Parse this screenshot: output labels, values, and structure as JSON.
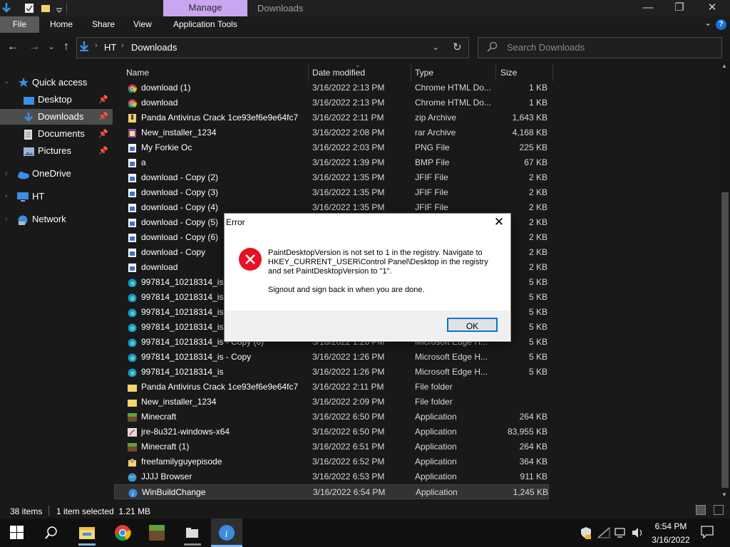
{
  "window": {
    "title": "Downloads",
    "manage_tab": "Manage",
    "controls": {
      "minimize": "—",
      "maximize": "❐",
      "close": "✕"
    }
  },
  "ribbon": {
    "tabs": [
      "File",
      "Home",
      "Share",
      "View",
      "Application Tools"
    ]
  },
  "address": {
    "crumbs": [
      "HT",
      "Downloads"
    ],
    "search_placeholder": "Search Downloads"
  },
  "nav_pane": {
    "items": [
      {
        "label": "Quick access",
        "icon": "star-icon"
      },
      {
        "label": "Desktop",
        "icon": "desktop-icon",
        "pinned": true
      },
      {
        "label": "Downloads",
        "icon": "downloads-icon",
        "pinned": true,
        "selected": true
      },
      {
        "label": "Documents",
        "icon": "documents-icon",
        "pinned": true
      },
      {
        "label": "Pictures",
        "icon": "pictures-icon",
        "pinned": true
      },
      {
        "label": "OneDrive",
        "icon": "cloud-icon"
      },
      {
        "label": "HT",
        "icon": "computer-icon"
      },
      {
        "label": "Network",
        "icon": "network-icon"
      }
    ]
  },
  "columns": {
    "name": "Name",
    "date": "Date modified",
    "type": "Type",
    "size": "Size"
  },
  "files": [
    {
      "name": "download (1)",
      "date": "3/16/2022 2:13 PM",
      "type": "Chrome HTML Do...",
      "size": "1 KB",
      "icon": "chrome-icon"
    },
    {
      "name": "download",
      "date": "3/16/2022 2:13 PM",
      "type": "Chrome HTML Do...",
      "size": "1 KB",
      "icon": "chrome-icon"
    },
    {
      "name": "Panda Antivirus Crack 1ce93ef6e9e64fc7",
      "date": "3/16/2022 2:11 PM",
      "type": "zip Archive",
      "size": "1,643 KB",
      "icon": "zip-archive-icon"
    },
    {
      "name": "New_installer_1234",
      "date": "3/16/2022 2:08 PM",
      "type": "rar Archive",
      "size": "4,168 KB",
      "icon": "rar-archive-icon"
    },
    {
      "name": "My Forkie Oc",
      "date": "3/16/2022 2:03 PM",
      "type": "PNG File",
      "size": "225 KB",
      "icon": "image-file-icon"
    },
    {
      "name": "a",
      "date": "3/16/2022 1:39 PM",
      "type": "BMP File",
      "size": "67 KB",
      "icon": "image-file-icon"
    },
    {
      "name": "download - Copy (2)",
      "date": "3/16/2022 1:35 PM",
      "type": "JFIF File",
      "size": "2 KB",
      "icon": "image-file-icon"
    },
    {
      "name": "download - Copy (3)",
      "date": "3/16/2022 1:35 PM",
      "type": "JFIF File",
      "size": "2 KB",
      "icon": "image-file-icon"
    },
    {
      "name": "download - Copy (4)",
      "date": "3/16/2022 1:35 PM",
      "type": "JFIF File",
      "size": "2 KB",
      "icon": "image-file-icon"
    },
    {
      "name": "download - Copy (5)",
      "date": "",
      "type": "",
      "size": "2 KB",
      "icon": "image-file-icon"
    },
    {
      "name": "download - Copy (6)",
      "date": "",
      "type": "",
      "size": "2 KB",
      "icon": "image-file-icon"
    },
    {
      "name": "download - Copy",
      "date": "",
      "type": "",
      "size": "2 KB",
      "icon": "image-file-icon"
    },
    {
      "name": "download",
      "date": "",
      "type": "",
      "size": "2 KB",
      "icon": "image-file-icon"
    },
    {
      "name": "997814_10218314_is - C",
      "date": "",
      "type": "",
      "size": "5 KB",
      "icon": "edge-icon"
    },
    {
      "name": "997814_10218314_is - C",
      "date": "",
      "type": "",
      "size": "5 KB",
      "icon": "edge-icon"
    },
    {
      "name": "997814_10218314_is - C",
      "date": "",
      "type": "",
      "size": "5 KB",
      "icon": "edge-icon"
    },
    {
      "name": "997814_10218314_is - C",
      "date": "",
      "type": "",
      "size": "5 KB",
      "icon": "edge-icon"
    },
    {
      "name": "997814_10218314_is - Copy (6)",
      "date": "3/16/2022 1:26 PM",
      "type": "Microsoft Edge H...",
      "size": "5 KB",
      "icon": "edge-icon"
    },
    {
      "name": "997814_10218314_is - Copy",
      "date": "3/16/2022 1:26 PM",
      "type": "Microsoft Edge H...",
      "size": "5 KB",
      "icon": "edge-icon"
    },
    {
      "name": "997814_10218314_is",
      "date": "3/16/2022 1:26 PM",
      "type": "Microsoft Edge H...",
      "size": "5 KB",
      "icon": "edge-icon"
    },
    {
      "name": "Panda Antivirus Crack 1ce93ef6e9e64fc7",
      "date": "3/16/2022 2:11 PM",
      "type": "File folder",
      "size": "",
      "icon": "folder-icon"
    },
    {
      "name": "New_installer_1234",
      "date": "3/16/2022 2:09 PM",
      "type": "File folder",
      "size": "",
      "icon": "folder-icon"
    },
    {
      "name": "Minecraft",
      "date": "3/16/2022 6:50 PM",
      "type": "Application",
      "size": "264 KB",
      "icon": "minecraft-icon"
    },
    {
      "name": "jre-8u321-windows-x64",
      "date": "3/16/2022 6:50 PM",
      "type": "Application",
      "size": "83,955 KB",
      "icon": "java-installer-icon"
    },
    {
      "name": "Minecraft (1)",
      "date": "3/16/2022 6:51 PM",
      "type": "Application",
      "size": "264 KB",
      "icon": "minecraft-icon"
    },
    {
      "name": "freefamilyguyepisode",
      "date": "3/16/2022 6:52 PM",
      "type": "Application",
      "size": "364 KB",
      "icon": "app-icon"
    },
    {
      "name": "JJJJ Browser",
      "date": "3/16/2022 6:53 PM",
      "type": "Application",
      "size": "911 KB",
      "icon": "globe-icon"
    },
    {
      "name": "WinBuildChange",
      "date": "3/16/2022 6:54 PM",
      "type": "Application",
      "size": "1,245 KB",
      "icon": "info-app-icon",
      "selected": true
    }
  ],
  "status": {
    "items": "38 items",
    "selection": "1 item selected  1.21 MB"
  },
  "dialog": {
    "title": "Error",
    "message": "PaintDesktopVersion is not set to 1 in the registry. Navigate to HKEY_CURRENT_USER\\Control Panel\\Desktop in the registry and set PaintDesktopVersion to \"1\".",
    "message2": "Signout and sign back in when you are done.",
    "ok_label": "OK"
  },
  "taskbar": {
    "time": "6:54 PM",
    "date": "3/16/2022",
    "apps": [
      "start-icon",
      "search-icon",
      "file-explorer-icon",
      "chrome-icon",
      "minecraft-icon",
      "folder-app-icon",
      "info-app-icon"
    ]
  },
  "colors": {
    "accent": "#0078d7",
    "manage_tab": "#c9a7f0",
    "error_red": "#e81123"
  }
}
